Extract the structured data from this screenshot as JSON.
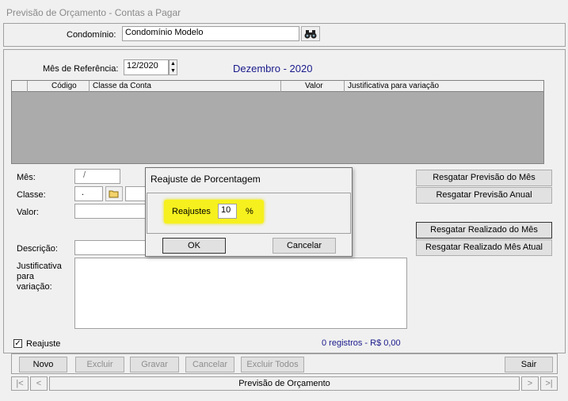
{
  "window": {
    "title": "Previsão de Orçamento - Contas a Pagar"
  },
  "header": {
    "condominio_label": "Condomínio:",
    "condominio_value": "Condomínio Modelo",
    "search_icon": "binoculars-icon"
  },
  "reference": {
    "label": "Mês de Referência:",
    "value": "12/2020",
    "display": "Dezembro - 2020"
  },
  "grid": {
    "columns": [
      "Código",
      "Classe da Conta",
      "Valor",
      "Justificativa para variação"
    ],
    "rows": []
  },
  "form": {
    "mes_label": "Mês:",
    "mes_value": "/",
    "classe_label": "Classe:",
    "classe_value": ".",
    "valor_label": "Valor:",
    "descricao_label": "Descrição:",
    "justificativa_label_1": "Justificativa",
    "justificativa_label_2": "para",
    "justificativa_label_3": "variação:"
  },
  "side_buttons": {
    "previsao_mes": "Resgatar Previsão do Mês",
    "previsao_anual": "Resgatar Previsão Anual",
    "realizado_mes": "Resgatar Realizado do Mês",
    "realizado_mes_atual": "Resgatar Realizado Mês Atual"
  },
  "reajuste": {
    "label": "Reajuste",
    "checked": true
  },
  "status": {
    "records": "0 registros - R$ 0,00"
  },
  "toolbar": {
    "novo": "Novo",
    "excluir": "Excluir",
    "gravar": "Gravar",
    "cancelar": "Cancelar",
    "excluir_todos": "Excluir Todos",
    "sair": "Sair"
  },
  "navigator": {
    "first": "|<",
    "prev": "<",
    "label": "Previsão de Orçamento",
    "next": ">",
    "last": ">|"
  },
  "dialog": {
    "title": "Reajuste de Porcentagem",
    "field_label": "Reajustes",
    "field_value": "10",
    "unit": "%",
    "ok": "OK",
    "cancel": "Cancelar"
  }
}
